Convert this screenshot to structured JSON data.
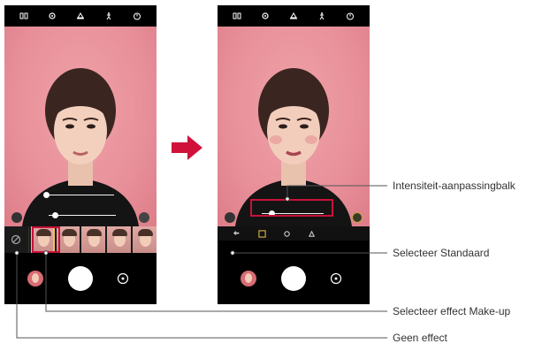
{
  "labels": {
    "intensity_bar": "Intensiteit-aanpassingbalk",
    "select_default": "Selecteer Standaard",
    "select_makeup": "Selecteer effect Make-up",
    "no_effect": "Geen effect"
  },
  "top_bar_icons": [
    "aspect-ratio-icon",
    "settings-icon",
    "cloud-icon",
    "figure-icon",
    "timer-icon"
  ],
  "left_phone": {
    "sliders": [
      {
        "name": "beauty-slider-1",
        "level": 0.05
      },
      {
        "name": "beauty-slider-2",
        "level": 0.1
      }
    ],
    "effect_thumbs": 5,
    "selected_effect_index": 0
  },
  "right_phone": {
    "intensity_level": 0.15,
    "menu_icons": [
      "back-icon",
      "default-icon",
      "makeup-icon",
      "style-icon"
    ]
  },
  "colors": {
    "accent": "#c8113a",
    "viewfinder_bg": "#e8909a",
    "arrow": "#d0113a"
  }
}
